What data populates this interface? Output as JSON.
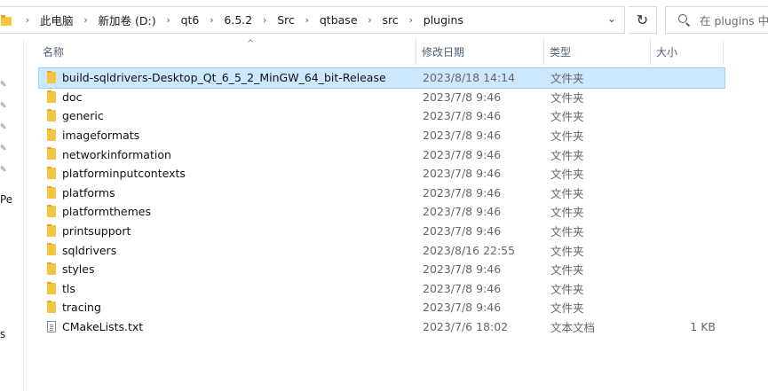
{
  "address": {
    "crumbs": [
      "此电脑",
      "新加卷 (D:)",
      "qt6",
      "6.5.2",
      "Src",
      "qtbase",
      "src",
      "plugins"
    ],
    "search_placeholder": "在 plugins 中"
  },
  "nav": {
    "fragments": [
      "Pe",
      "s"
    ]
  },
  "columns": {
    "name": "名称",
    "date": "修改日期",
    "type": "类型",
    "size": "大小"
  },
  "files": [
    {
      "name": "build-sqldrivers-Desktop_Qt_6_5_2_MinGW_64_bit-Release",
      "date": "2023/8/18 14:14",
      "type": "文件夹",
      "size": "",
      "kind": "folder",
      "selected": true
    },
    {
      "name": "doc",
      "date": "2023/7/8 9:46",
      "type": "文件夹",
      "size": "",
      "kind": "folder"
    },
    {
      "name": "generic",
      "date": "2023/7/8 9:46",
      "type": "文件夹",
      "size": "",
      "kind": "folder"
    },
    {
      "name": "imageformats",
      "date": "2023/7/8 9:46",
      "type": "文件夹",
      "size": "",
      "kind": "folder"
    },
    {
      "name": "networkinformation",
      "date": "2023/7/8 9:46",
      "type": "文件夹",
      "size": "",
      "kind": "folder"
    },
    {
      "name": "platforminputcontexts",
      "date": "2023/7/8 9:46",
      "type": "文件夹",
      "size": "",
      "kind": "folder"
    },
    {
      "name": "platforms",
      "date": "2023/7/8 9:46",
      "type": "文件夹",
      "size": "",
      "kind": "folder"
    },
    {
      "name": "platformthemes",
      "date": "2023/7/8 9:46",
      "type": "文件夹",
      "size": "",
      "kind": "folder"
    },
    {
      "name": "printsupport",
      "date": "2023/7/8 9:46",
      "type": "文件夹",
      "size": "",
      "kind": "folder"
    },
    {
      "name": "sqldrivers",
      "date": "2023/8/16 22:55",
      "type": "文件夹",
      "size": "",
      "kind": "folder"
    },
    {
      "name": "styles",
      "date": "2023/7/8 9:46",
      "type": "文件夹",
      "size": "",
      "kind": "folder"
    },
    {
      "name": "tls",
      "date": "2023/7/8 9:46",
      "type": "文件夹",
      "size": "",
      "kind": "folder"
    },
    {
      "name": "tracing",
      "date": "2023/7/8 9:46",
      "type": "文件夹",
      "size": "",
      "kind": "folder"
    },
    {
      "name": "CMakeLists.txt",
      "date": "2023/7/6 18:02",
      "type": "文本文档",
      "size": "1 KB",
      "kind": "file"
    }
  ],
  "colors": {
    "selection_bg": "#cce8ff",
    "selection_border": "#99d1ff",
    "folder_yellow": "#f6c53f",
    "header_text": "#4c607a"
  },
  "icons": {
    "folder": "folder-icon",
    "file": "text-file-icon",
    "search": "search-icon",
    "refresh": "refresh-icon",
    "pin": "pin-icon"
  }
}
